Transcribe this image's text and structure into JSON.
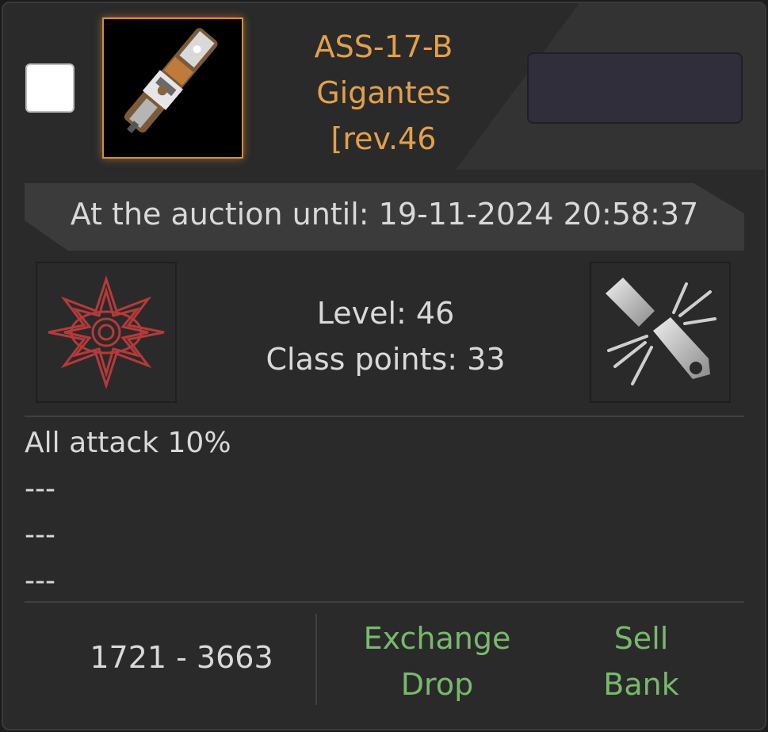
{
  "item": {
    "title_lines": [
      "ASS-17-B",
      "Gigantes",
      "[rev.46"
    ],
    "icon": "weapon-gun-icon",
    "accent_color": "#e3a04a"
  },
  "auction": {
    "text": "At the auction until: 19-11-2024 20:58:37"
  },
  "stats": {
    "level": "Level: 46",
    "class_points": "Class points: 33"
  },
  "badges": {
    "left_icon": "red-spiked-eye-emblem-icon",
    "right_icon": "broken-gun-icon"
  },
  "attributes": [
    "All attack 10%",
    "---",
    "---",
    "---"
  ],
  "price_range": "1721 - 3663",
  "actions": {
    "exchange": "Exchange",
    "drop": "Drop",
    "sell": "Sell",
    "bank": "Bank",
    "color": "#79b96d"
  }
}
